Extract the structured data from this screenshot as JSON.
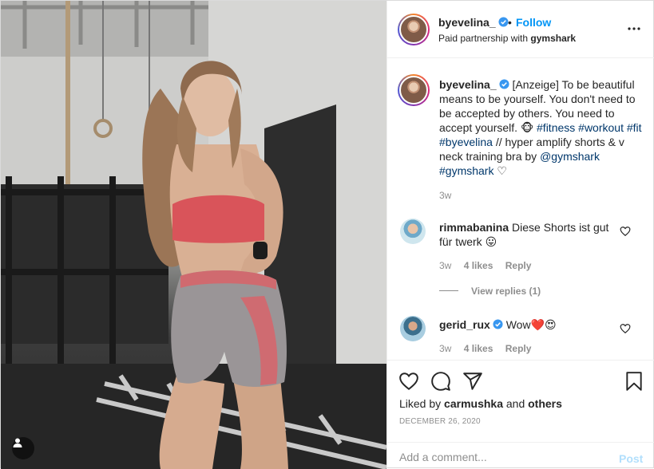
{
  "header": {
    "username": "byevelina_",
    "dot": "•",
    "follow_label": "Follow",
    "partnership_prefix": "Paid partnership with",
    "partnership_brand": "gymshark"
  },
  "caption": {
    "username": "byevelina_",
    "text_start": "[Anzeige] To be beautiful means to be yourself. You don't need to be accepted by others. You need to accept yourself. 🐵",
    "hashtags": [
      "#fitness",
      "#workout",
      "#fit",
      "#byevelina"
    ],
    "text_middle": "// hyper amplify shorts & v neck training bra by",
    "mention": "@gymshark",
    "hashtag_end": "#gymshark",
    "emoji_end": "♡",
    "time": "3w"
  },
  "comments": [
    {
      "username": "rimmabanina",
      "text": "Diese Shorts ist gut für twerk 😛",
      "time": "3w",
      "likes": "4 likes",
      "reply_label": "Reply",
      "view_replies": "View replies (1)"
    },
    {
      "username": "gerid_rux",
      "text": "Wow❤️😍",
      "time": "3w",
      "likes": "4 likes",
      "reply_label": "Reply"
    }
  ],
  "likes": {
    "prefix": "Liked by",
    "user": "carmushka",
    "and": "and",
    "others": "others"
  },
  "date": "DECEMBER 26, 2020",
  "add_comment": {
    "placeholder": "Add a comment...",
    "post_label": "Post"
  },
  "colors": {
    "accent": "#0095f6",
    "hashtag": "#00376b",
    "muted": "#8e8e8e",
    "post_disabled": "#b2dffc",
    "heart_red": "#ed4956",
    "top_color": "#d9545a",
    "shorts_grey": "#9a9597"
  },
  "icons": [
    "verified-badge-icon",
    "more-options-icon",
    "heart-icon",
    "comment-icon",
    "share-icon",
    "bookmark-icon",
    "user-tag-icon"
  ]
}
